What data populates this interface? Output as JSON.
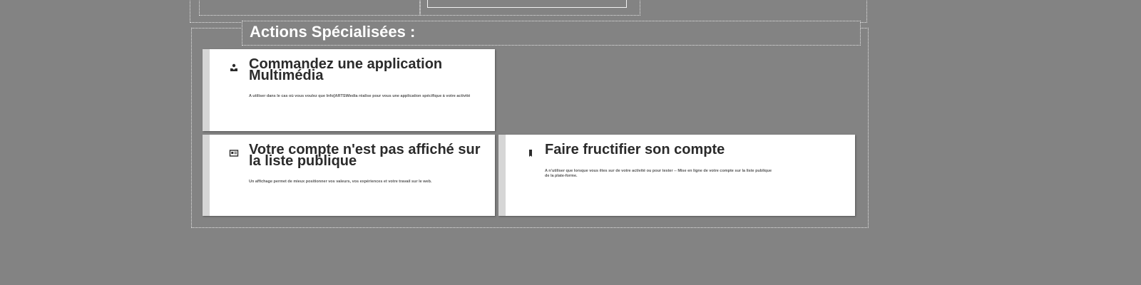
{
  "section": {
    "title": "Actions Spécialisées :"
  },
  "cards": [
    {
      "icon": "user-download-icon",
      "title": "Commandez une application Multimédia",
      "description": "A utiliser dans le cas où vous voulez que Info[ARTS\\Media réalise pour vous une application spécifique à votre activité"
    },
    {
      "icon": "id-card-icon",
      "title": "Votre compte n'est pas affiché sur la liste publique",
      "description": "Un affichage permet de mieux positionner vos valeurs, vos expériences et votre travail sur le web."
    },
    {
      "icon": "bookmark-icon",
      "title": "Faire fructifier son compte",
      "description": "A n'utiliser que lorsque vous êtes sur de votre activité ou pour tester -- Mise en ligne de votre compte sur la liste publique de la plate-forme."
    }
  ],
  "colors": {
    "background": "#838383",
    "card": "#ffffff",
    "card_accent_bar": "#d6d6d6",
    "title_text": "#2b2b2b",
    "legend_text": "#ffffff"
  }
}
